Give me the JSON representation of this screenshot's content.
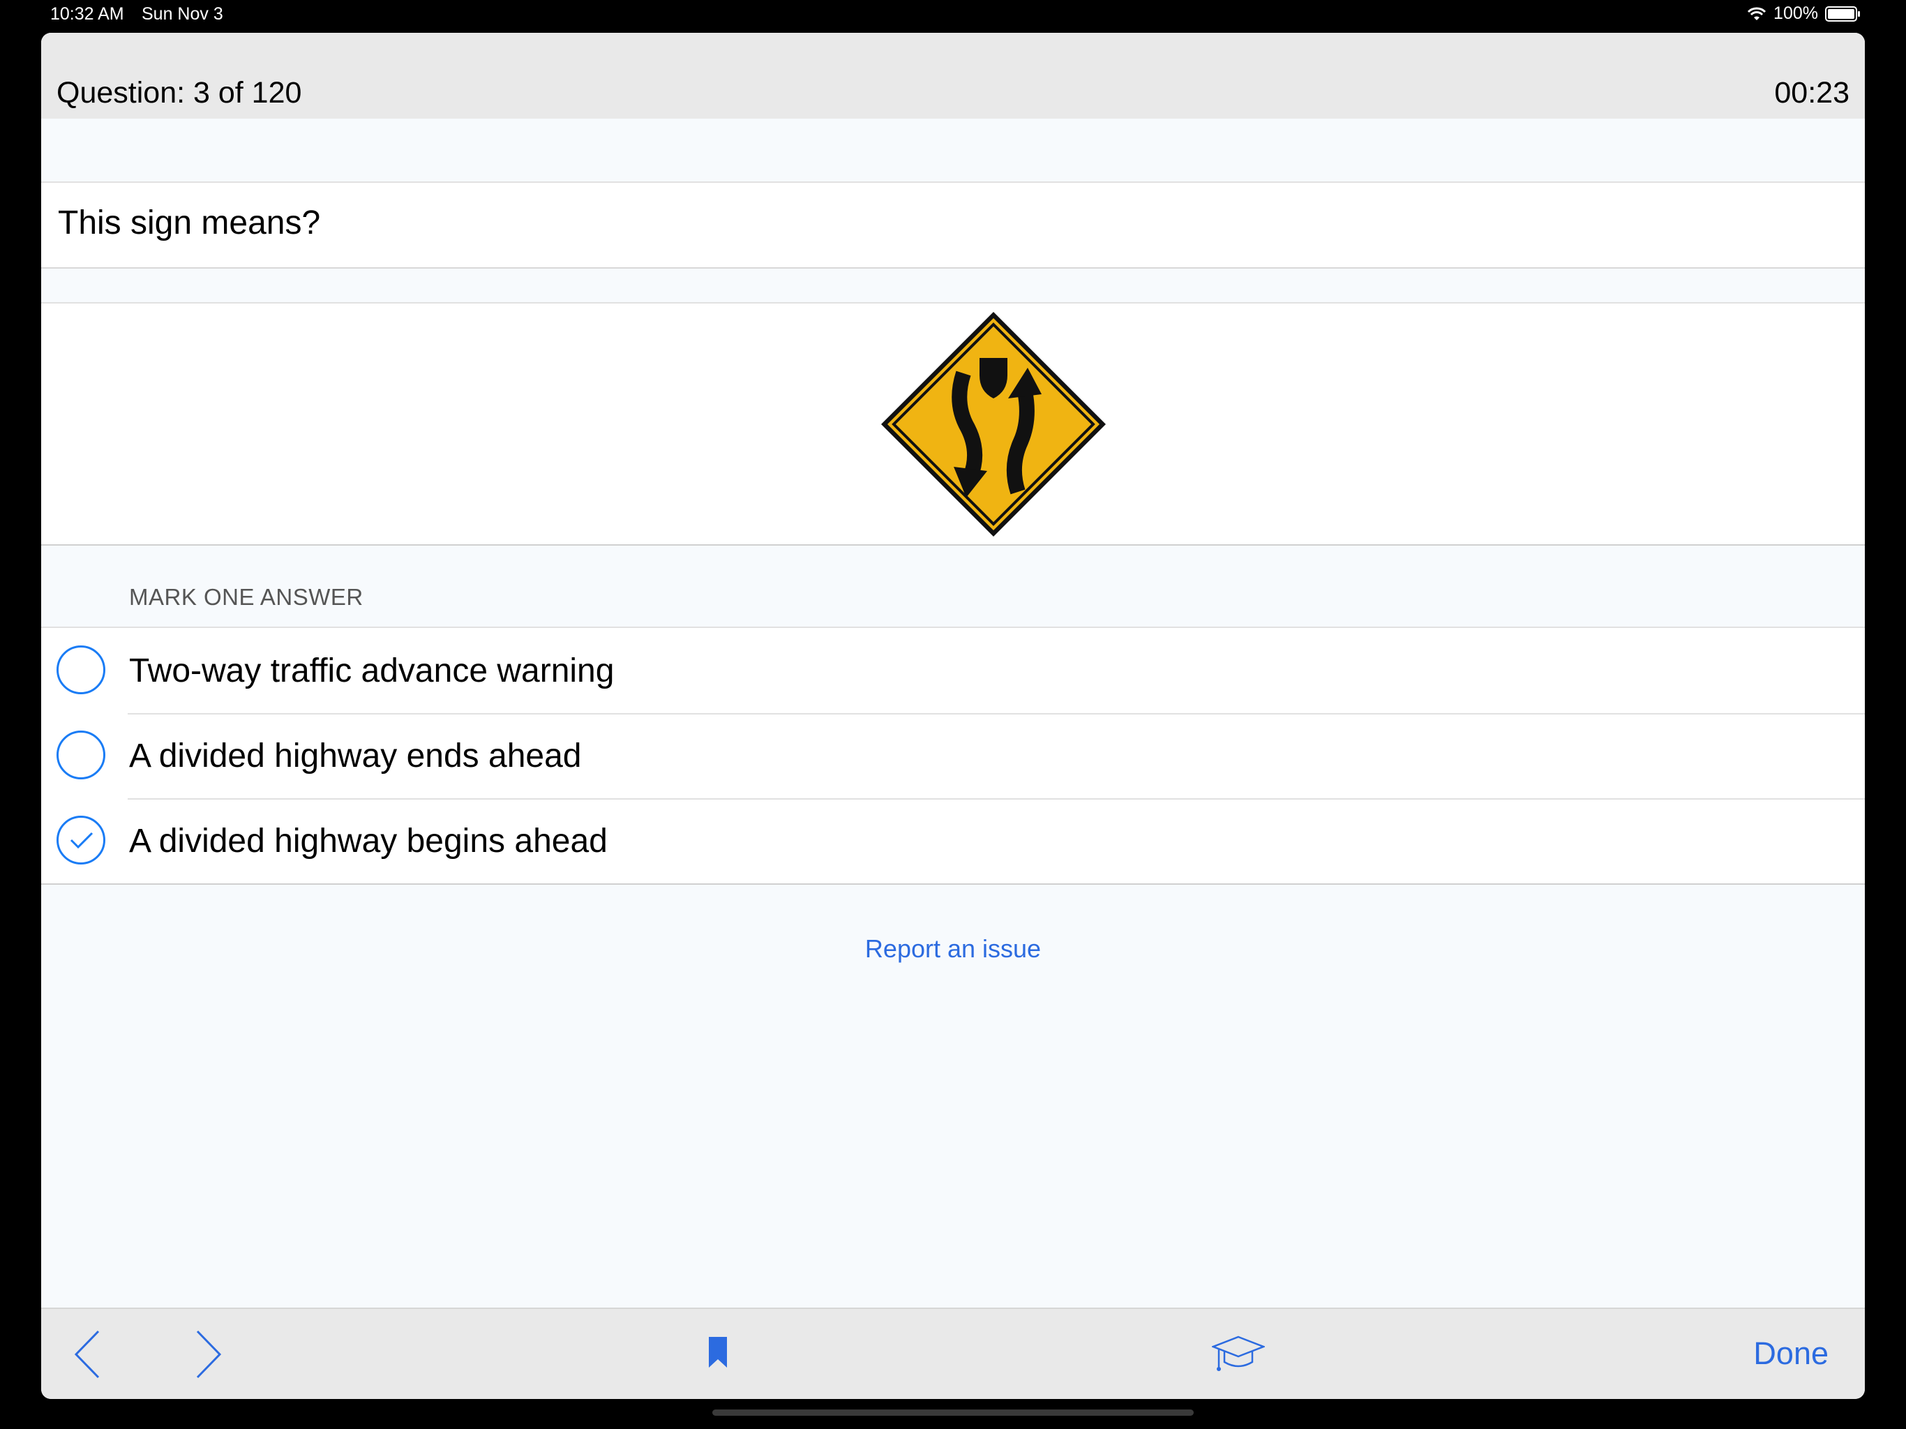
{
  "status_bar": {
    "time": "10:32 AM",
    "date": "Sun Nov 3",
    "battery": "100%"
  },
  "header": {
    "question_counter": "Question: 3 of 120",
    "timer": "00:23"
  },
  "question": {
    "text": "This sign means?",
    "image_icon": "divided-highway-sign-icon"
  },
  "answers_section": {
    "label": "MARK ONE ANSWER",
    "options": [
      {
        "text": "Two-way traffic advance warning",
        "selected": false
      },
      {
        "text": "A divided highway ends ahead",
        "selected": false
      },
      {
        "text": "A divided highway begins ahead",
        "selected": true
      }
    ]
  },
  "report_link": "Report an issue",
  "toolbar": {
    "back_icon": "chevron-left-icon",
    "forward_icon": "chevron-right-icon",
    "bookmark_icon": "bookmark-icon",
    "study_icon": "graduation-cap-icon",
    "done_label": "Done"
  },
  "colors": {
    "accent": "#1a7cf5",
    "link": "#2c6be0",
    "sign_yellow": "#f0b412"
  }
}
